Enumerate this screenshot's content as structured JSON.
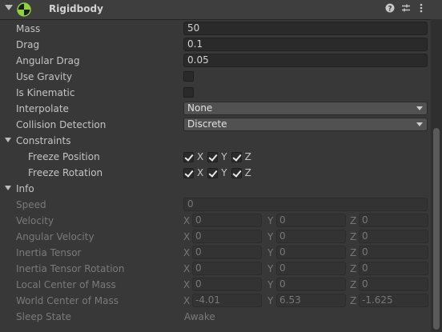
{
  "header": {
    "title": "Rigidbody",
    "icons": [
      "help-icon",
      "preset-icon",
      "more-icon"
    ]
  },
  "fields": {
    "mass": {
      "label": "Mass",
      "value": "50"
    },
    "drag": {
      "label": "Drag",
      "value": "0.1"
    },
    "angular_drag": {
      "label": "Angular Drag",
      "value": "0.05"
    },
    "use_gravity": {
      "label": "Use Gravity"
    },
    "is_kinematic": {
      "label": "Is Kinematic"
    },
    "interpolate": {
      "label": "Interpolate",
      "value": "None"
    },
    "collision_detection": {
      "label": "Collision Detection",
      "value": "Discrete"
    }
  },
  "constraints": {
    "label": "Constraints",
    "freeze_position": {
      "label": "Freeze Position",
      "axes": [
        "X",
        "Y",
        "Z"
      ]
    },
    "freeze_rotation": {
      "label": "Freeze Rotation",
      "axes": [
        "X",
        "Y",
        "Z"
      ]
    }
  },
  "info": {
    "label": "Info",
    "speed": {
      "label": "Speed",
      "value": "0"
    },
    "axis_labels": [
      "X",
      "Y",
      "Z"
    ],
    "velocity": {
      "label": "Velocity",
      "x": "0",
      "y": "0",
      "z": "0"
    },
    "angular_velocity": {
      "label": "Angular Velocity",
      "x": "0",
      "y": "0",
      "z": "0"
    },
    "inertia_tensor": {
      "label": "Inertia Tensor",
      "x": "0",
      "y": "0",
      "z": "0"
    },
    "inertia_tensor_rotation": {
      "label": "Inertia Tensor Rotation",
      "x": "0",
      "y": "0",
      "z": "0"
    },
    "local_center_of_mass": {
      "label": "Local Center of Mass",
      "x": "0",
      "y": "0",
      "z": "0"
    },
    "world_center_of_mass": {
      "label": "World Center of Mass",
      "x": "-4.01",
      "y": "6.53",
      "z": "-1.625"
    },
    "sleep_state": {
      "label": "Sleep State",
      "value": "Awake"
    }
  }
}
